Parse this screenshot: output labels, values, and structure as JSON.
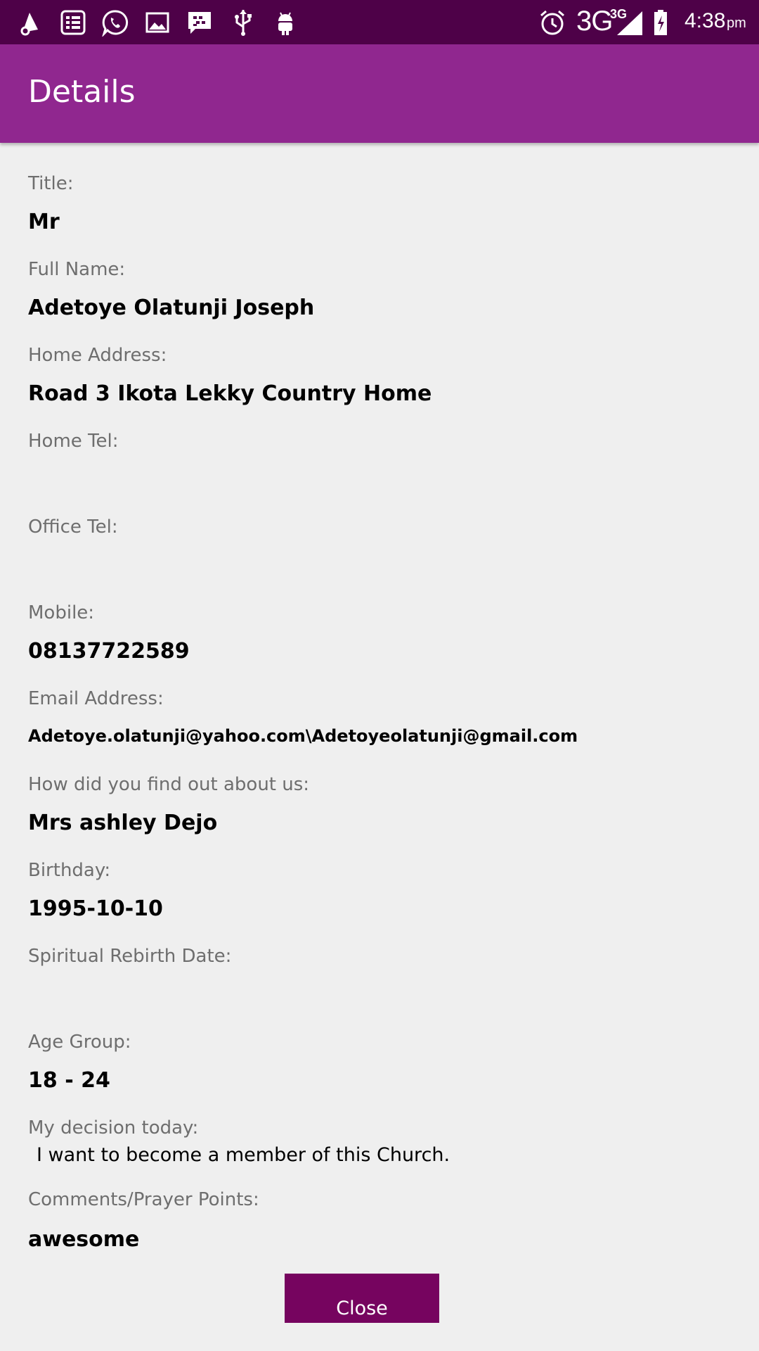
{
  "status_bar": {
    "network": "3G",
    "network_small": "3G",
    "time": "4:38",
    "ampm": "pm",
    "icons": [
      "notification-icon",
      "news-icon",
      "whatsapp-icon",
      "gallery-icon",
      "bbm-icon",
      "usb-icon",
      "android-icon",
      "alarm-icon",
      "signal-icon",
      "battery-icon"
    ]
  },
  "header": {
    "title": "Details"
  },
  "fields": {
    "title": {
      "label": "Title:",
      "value": "Mr"
    },
    "full_name": {
      "label": "Full Name:",
      "value": "Adetoye Olatunji Joseph"
    },
    "home_address": {
      "label": "Home Address:",
      "value": "Road 3 Ikota Lekky Country Home"
    },
    "home_tel": {
      "label": "Home Tel:",
      "value": ""
    },
    "office_tel": {
      "label": "Office Tel:",
      "value": ""
    },
    "mobile": {
      "label": "Mobile:",
      "value": "08137722589"
    },
    "email": {
      "label": "Email Address:",
      "value": "Adetoye.olatunji@yahoo.com\\Adetoyeolatunji@gmail.com"
    },
    "find_out": {
      "label": "How did you find out about us:",
      "value": "Mrs ashley Dejo"
    },
    "birthday": {
      "label": "Birthday:",
      "value": "1995-10-10"
    },
    "rebirth_date": {
      "label": "Spiritual Rebirth Date:",
      "value": ""
    },
    "age_group": {
      "label": "Age Group:",
      "value": "18 - 24"
    },
    "decision": {
      "label": "My decision today:",
      "value": "I want to become a member of this Church."
    },
    "comments": {
      "label": "Comments/Prayer Points:",
      "value": "awesome"
    }
  },
  "actions": {
    "close_label": "Close"
  },
  "colors": {
    "status_bar": "#4e0148",
    "app_bar": "#90278f",
    "close_button": "#76045f",
    "background": "#efefef"
  }
}
